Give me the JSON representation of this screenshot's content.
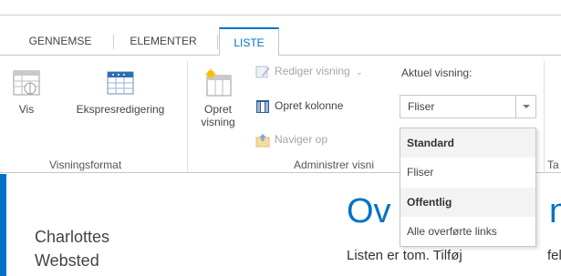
{
  "tabs": [
    {
      "label": "GENNEMSE",
      "active": false
    },
    {
      "label": "ELEMENTER",
      "active": false
    },
    {
      "label": "LISTE",
      "active": true
    }
  ],
  "ribbon": {
    "groups": [
      {
        "label": "Visningsformat"
      },
      {
        "label": "Administrer visni"
      },
      {
        "label": "Ta"
      }
    ],
    "vis": {
      "label": "Vis",
      "icon": "table-view-icon"
    },
    "ekspres": {
      "label": "Ekspresredigering",
      "icon": "datasheet-icon"
    },
    "opret_visning": {
      "line1": "Opret",
      "line2": "visning",
      "icon": "create-view-icon"
    },
    "rediger_visning": {
      "label": "Rediger visning",
      "disabled": true,
      "icon": "edit-view-icon"
    },
    "opret_kolonne": {
      "label": "Opret kolonne",
      "icon": "add-column-icon"
    },
    "naviger_op": {
      "label": "Naviger op",
      "disabled": true,
      "icon": "navigate-up-icon"
    },
    "aktuel_visning": {
      "label": "Aktuel visning:",
      "selected": "Fliser"
    }
  },
  "view_menu": {
    "sections": [
      {
        "header": "Standard",
        "items": [
          "Fliser"
        ]
      },
      {
        "header": "Offentlig",
        "items": [
          "Alle overførte links"
        ]
      }
    ]
  },
  "page": {
    "site_name_line1": "Charlottes",
    "site_name_line2": "Websted",
    "title_start": "Ov",
    "title_end": "n",
    "empty_message": "Listen er tom. Tilføj",
    "empty_message_end": "felte"
  },
  "colors": {
    "accent": "#0072c6",
    "text": "#444444",
    "border": "#c6c6c6"
  }
}
